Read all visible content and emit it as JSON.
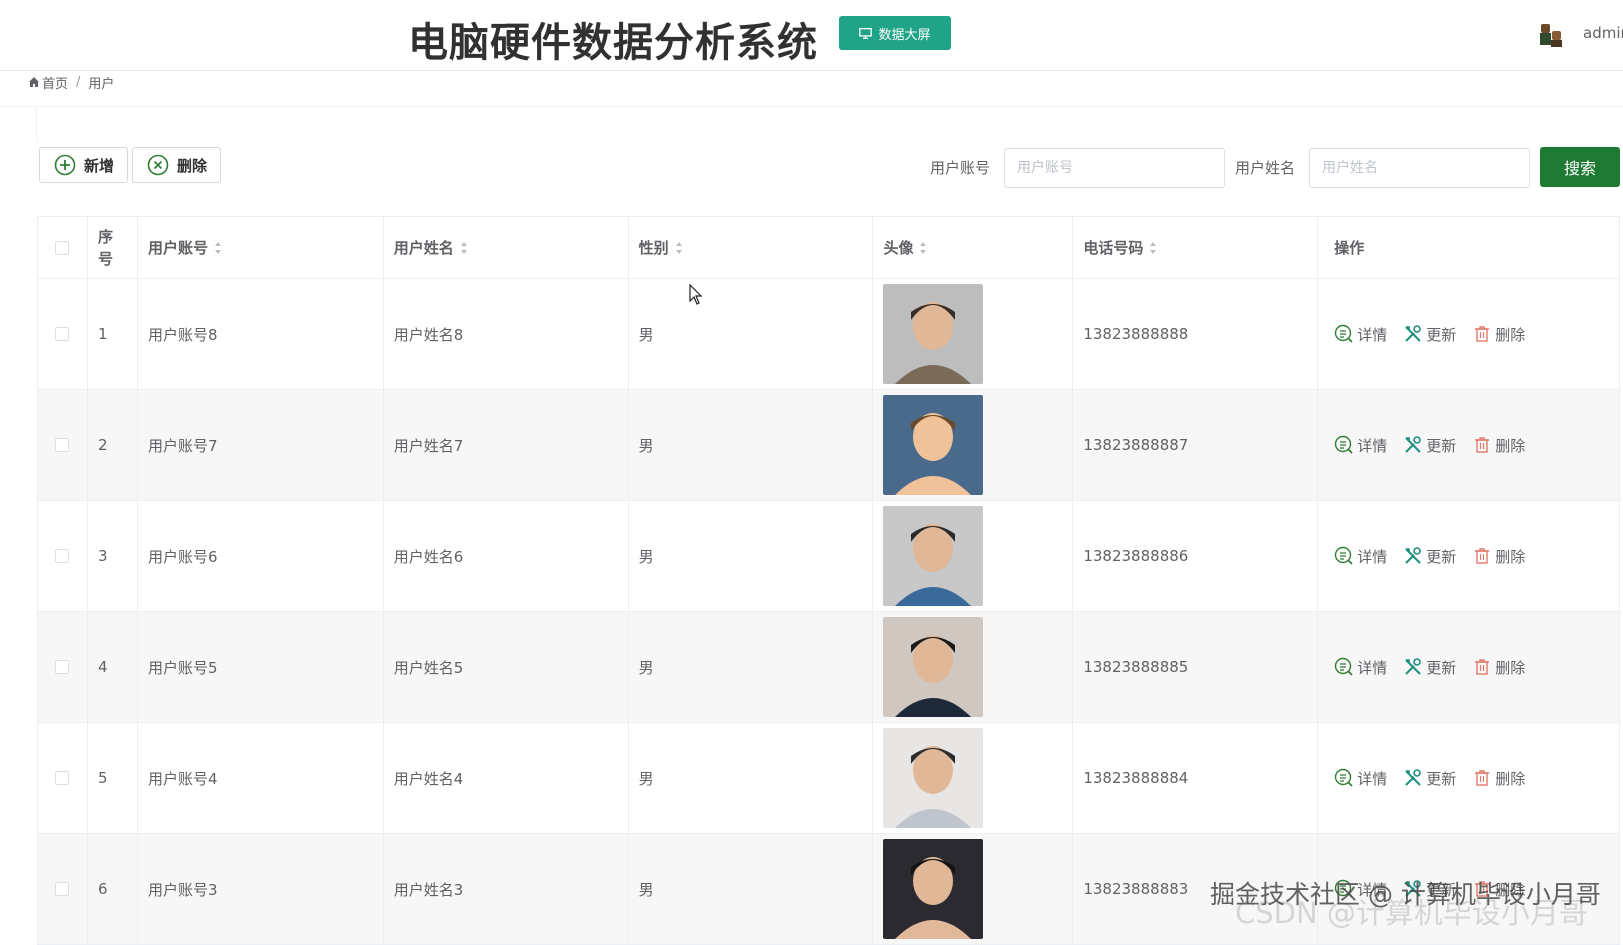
{
  "header": {
    "title": "电脑硬件数据分析系统",
    "screen_button": "数据大屏",
    "username": "admin"
  },
  "breadcrumb": {
    "home": "首页",
    "separator": "/",
    "current": "用户"
  },
  "toolbar": {
    "add_label": "新增",
    "delete_label": "删除",
    "account_label": "用户账号",
    "account_placeholder": "用户账号",
    "name_label": "用户姓名",
    "name_placeholder": "用户姓名",
    "search_label": "搜索"
  },
  "table": {
    "columns": [
      "序号",
      "用户账号",
      "用户姓名",
      "性别",
      "头像",
      "电话号码",
      "操作"
    ],
    "rows": [
      {
        "index": "1",
        "account": "用户账号8",
        "name": "用户姓名8",
        "sex": "男",
        "phone": "13823888888"
      },
      {
        "index": "2",
        "account": "用户账号7",
        "name": "用户姓名7",
        "sex": "男",
        "phone": "13823888887"
      },
      {
        "index": "3",
        "account": "用户账号6",
        "name": "用户姓名6",
        "sex": "男",
        "phone": "13823888886"
      },
      {
        "index": "4",
        "account": "用户账号5",
        "name": "用户姓名5",
        "sex": "男",
        "phone": "13823888885"
      },
      {
        "index": "5",
        "account": "用户账号4",
        "name": "用户姓名4",
        "sex": "男",
        "phone": "13823888884"
      },
      {
        "index": "6",
        "account": "用户账号3",
        "name": "用户姓名3",
        "sex": "男",
        "phone": "13823888883"
      }
    ],
    "actions": {
      "detail": "详情",
      "update": "更新",
      "delete": "删除"
    }
  },
  "watermark": {
    "line1": "掘金技术社区 @ 计算机毕设小月哥",
    "line2": "CSDN @计算机毕设小月哥"
  },
  "colors": {
    "accent": "#1e7a33",
    "screen_button": "#20a386",
    "delete_icon": "#e07a6a"
  }
}
